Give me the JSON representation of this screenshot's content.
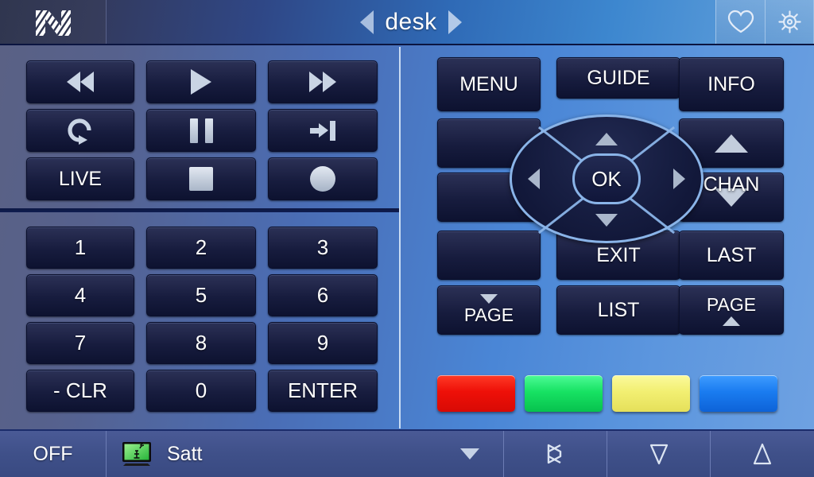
{
  "header": {
    "logo_name": "nevo-logo",
    "title": "desk",
    "prev_label": "◀",
    "next_label": "▶",
    "favorite_icon": "heart-icon",
    "settings_icon": "gear-icon"
  },
  "transport": {
    "keys": [
      {
        "id": "rewind",
        "icon": "rewind-icon",
        "label": ""
      },
      {
        "id": "play",
        "icon": "play-icon",
        "label": ""
      },
      {
        "id": "fast-forward",
        "icon": "fast-forward-icon",
        "label": ""
      },
      {
        "id": "replay",
        "icon": "replay-loop-icon",
        "label": ""
      },
      {
        "id": "pause",
        "icon": "pause-icon",
        "label": ""
      },
      {
        "id": "skip-end",
        "icon": "skip-to-end-icon",
        "label": ""
      },
      {
        "id": "live",
        "icon": "",
        "label": "LIVE"
      },
      {
        "id": "stop",
        "icon": "stop-icon",
        "label": ""
      },
      {
        "id": "record",
        "icon": "record-icon",
        "label": ""
      }
    ]
  },
  "keypad": {
    "keys": [
      {
        "id": "num-1",
        "label": "1"
      },
      {
        "id": "num-2",
        "label": "2"
      },
      {
        "id": "num-3",
        "label": "3"
      },
      {
        "id": "num-4",
        "label": "4"
      },
      {
        "id": "num-5",
        "label": "5"
      },
      {
        "id": "num-6",
        "label": "6"
      },
      {
        "id": "num-7",
        "label": "7"
      },
      {
        "id": "num-8",
        "label": "8"
      },
      {
        "id": "num-9",
        "label": "9"
      },
      {
        "id": "clear",
        "label": "- CLR"
      },
      {
        "id": "num-0",
        "label": "0"
      },
      {
        "id": "enter",
        "label": "ENTER"
      }
    ]
  },
  "control_panel": {
    "menu_label": "MENU",
    "guide_label": "GUIDE",
    "info_label": "INFO",
    "blank_left_upper_label": "",
    "blank_left_middle_label": "",
    "chan_label": "CHAN",
    "chan_up_icon": "triangle-up-icon",
    "chan_down_icon": "triangle-down-icon",
    "exit_label": "EXIT",
    "last_label": "LAST",
    "page_down_label": "PAGE",
    "page_down_icon": "triangle-down-icon",
    "list_label": "LIST",
    "page_up_label": "PAGE",
    "page_up_icon": "triangle-up-icon",
    "ok_label": "OK",
    "dpad_up_icon": "dpad-arrow-up-icon",
    "dpad_down_icon": "dpad-arrow-down-icon",
    "dpad_left_icon": "dpad-arrow-left-icon",
    "dpad_right_icon": "dpad-arrow-right-icon",
    "color_keys": [
      {
        "id": "red-key",
        "color": "#ef1111"
      },
      {
        "id": "green-key",
        "color": "#19dd63"
      },
      {
        "id": "yellow-key",
        "color": "#f2ef72"
      },
      {
        "id": "blue-key",
        "color": "#1f7ef0"
      }
    ]
  },
  "footer": {
    "off_label": "OFF",
    "device_label": "Satt",
    "device_icon": "satellite-tv-icon",
    "dropdown_icon": "caret-down-icon",
    "mute_icon": "mute-icon",
    "volume_down_icon": "volume-down-icon",
    "volume_up_icon": "volume-up-icon"
  },
  "colors": {
    "key_face": "#171c3e",
    "accent_blue": "#8ab4e8",
    "panel_bg": "#4a86d6"
  }
}
